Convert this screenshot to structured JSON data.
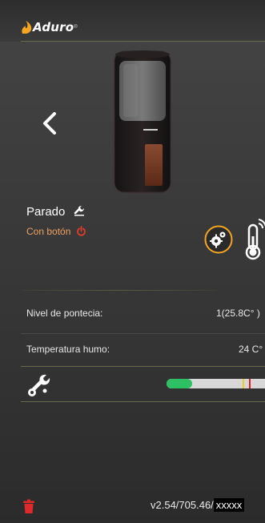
{
  "header": {
    "brand": "Aduro",
    "brand_mark": "®",
    "accent_color": "#f5a623"
  },
  "stove": {
    "status": "Parado",
    "mode": "Con botón"
  },
  "readings": [
    {
      "label": "Nivel de pontecia:",
      "value": "1(25.8C° )"
    },
    {
      "label": "Temperatura humo:",
      "value": "24 C°"
    }
  ],
  "progress": {
    "fill_fraction": 0.26,
    "colors": {
      "fill": "#2ec065",
      "track": "#d8d8d8",
      "marker_yellow": "#e8d020",
      "marker_red": "#e02020"
    }
  },
  "icons": [
    "flame-icon",
    "back-chevron-icon",
    "wrench-icon",
    "power-icon",
    "gear-icon",
    "thermometer-wifi-icon",
    "tools-icon",
    "trash-icon"
  ],
  "footer": {
    "version": "v2.54/705.46/",
    "serial": "xxxxx"
  }
}
